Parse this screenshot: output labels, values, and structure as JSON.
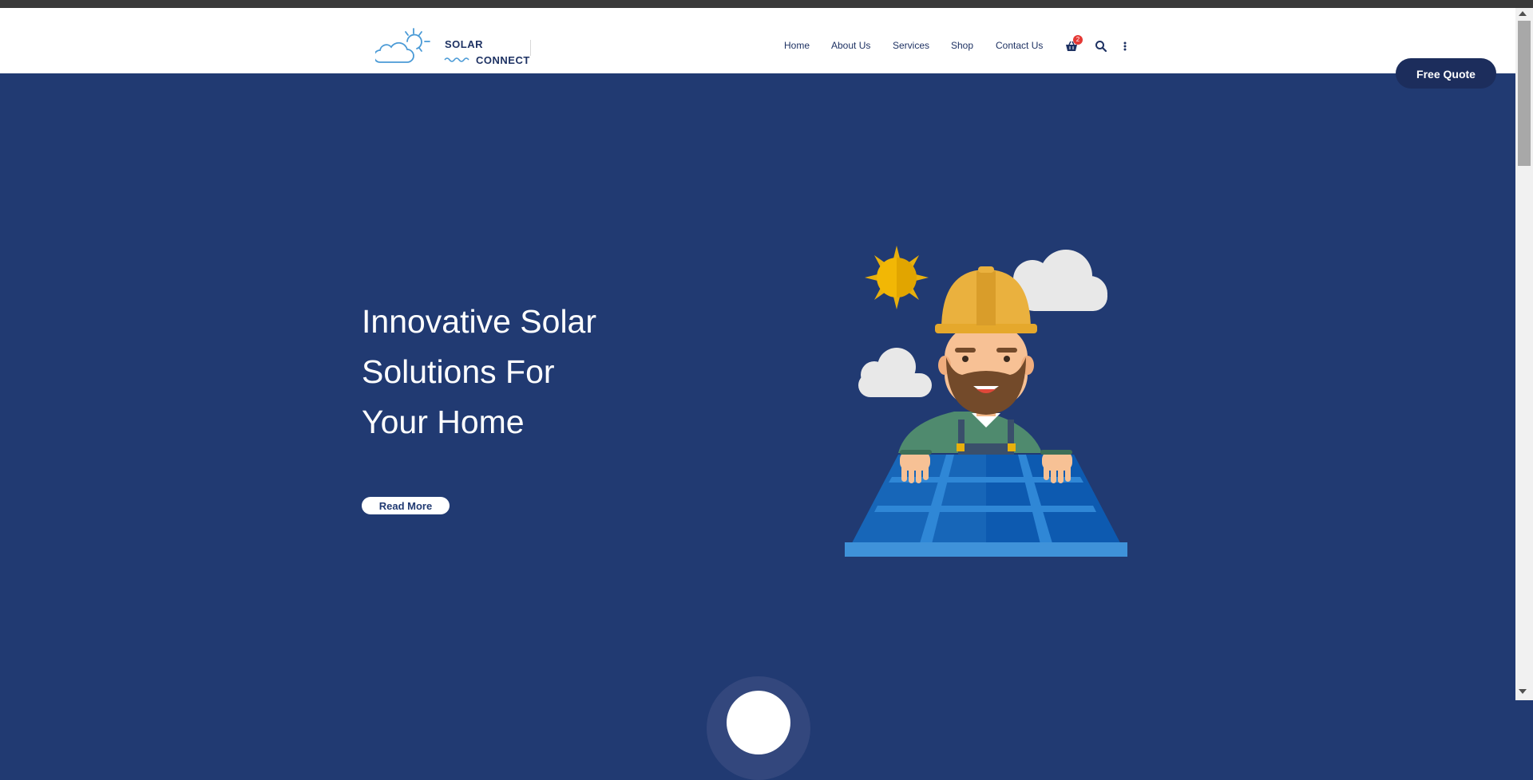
{
  "brand": {
    "line1": "SOLAR",
    "line2": "CONNECT",
    "color": "#1e3263",
    "icon": "sun-cloud-logo-icon"
  },
  "nav": {
    "items": [
      {
        "label": "Home"
      },
      {
        "label": "About Us"
      },
      {
        "label": "Services"
      },
      {
        "label": "Shop"
      },
      {
        "label": "Contact Us"
      }
    ],
    "cart_count": "2",
    "cart_icon": "shopping-basket-icon",
    "search_icon": "search-icon",
    "more_icon": "vertical-dots-icon"
  },
  "cta": {
    "free_quote": "Free Quote"
  },
  "hero": {
    "title_lines": [
      "Innovative Solar",
      "Solutions For",
      "Your Home"
    ],
    "read_more": "Read More",
    "background": "#213a72",
    "illustration": "solar-worker-illustration"
  }
}
